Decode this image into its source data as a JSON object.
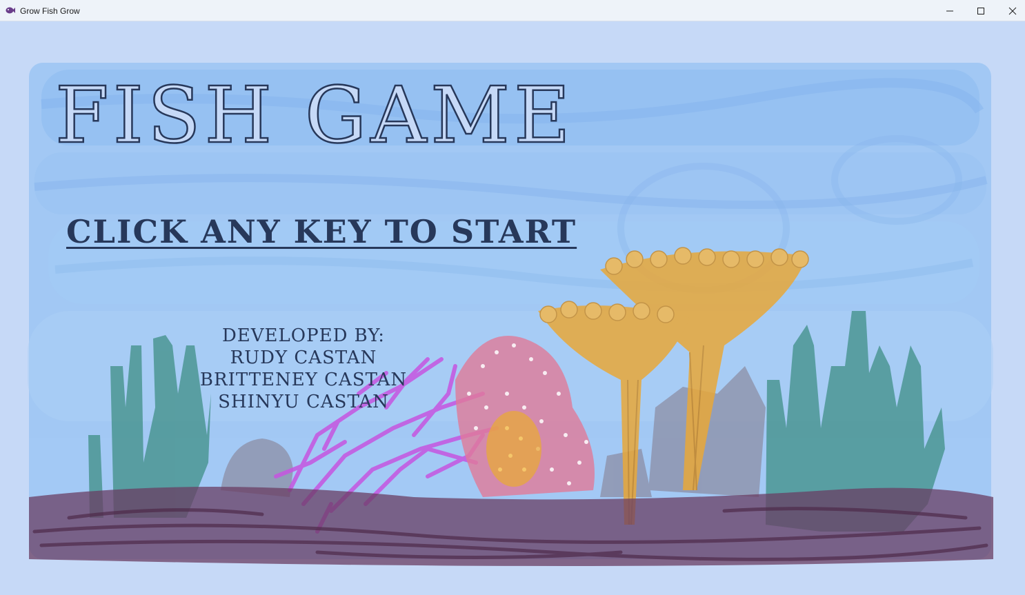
{
  "window": {
    "title": "Grow Fish Grow",
    "icon": "fish-app-icon",
    "controls": [
      "minimize",
      "maximize",
      "close"
    ]
  },
  "game": {
    "title": "Fish Game",
    "start_prompt": "Click any key to start",
    "credits": {
      "heading": "Developed by:",
      "developers": [
        "Rudy Castan",
        "Britteney Castan",
        "Shinyu Castan"
      ]
    }
  },
  "colors": {
    "background": "#c6d9f7",
    "water": "#8fbdf0",
    "text": "#27385a",
    "seaweed": "#3f8f86",
    "seafloor": "#6a3e63",
    "purple_coral": "#c655e0",
    "pink_coral": "#e07a98",
    "orange_coral": "#e8a83a"
  }
}
